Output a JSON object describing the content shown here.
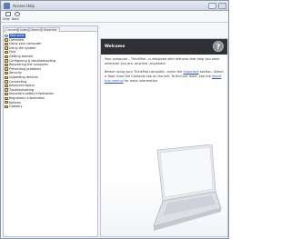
{
  "window": {
    "title": "Access Help"
  },
  "toolbar": {
    "hide_label": "Hide",
    "back_label": "Back"
  },
  "tabs": [
    "Contents",
    "Index",
    "Search",
    "Favorites"
  ],
  "toc": [
    "Welcome",
    "Overview",
    "Using your computer",
    "Using the system",
    "Find",
    "Getting started",
    "Configuring & troubleshooting",
    "Recovering the computer",
    "Preventing problems",
    "Security",
    "Upgrading devices",
    "Connecting",
    "Advanced topics",
    "Troubleshooting",
    "Important safety information",
    "Regulatory information",
    "Notices",
    "Glossary"
  ],
  "content": {
    "banner_title": "Welcome",
    "p1": "Your computer - ThinkPad - is designed with features that help you work wherever you are, anytime, anywhere.",
    "p2_a": "Before using your ThinkPad computer, check the ",
    "p2_link1": "Important",
    "p2_b": " section. Select a Topic from the Contents tab on the left. To find out more, see the ",
    "p2_link2": "About this manual",
    "p2_c": " for more information."
  },
  "colors": {
    "selection": "#3a64b8",
    "banner": "#2f3136",
    "link": "#2a55b0"
  }
}
